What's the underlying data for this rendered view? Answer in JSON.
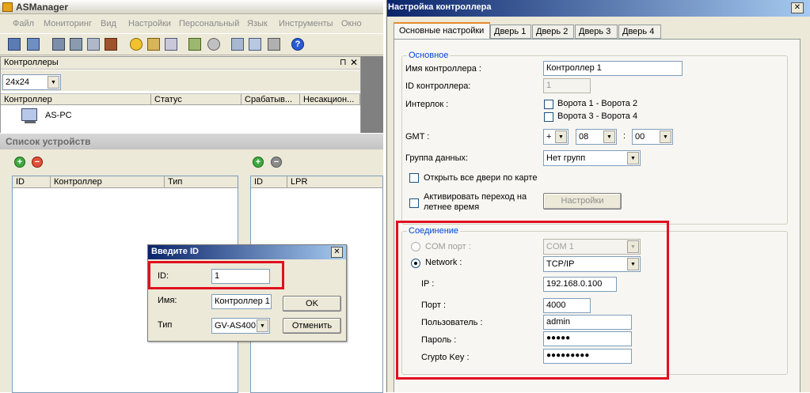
{
  "app": {
    "title": "ASManager",
    "menu": [
      "Файл",
      "Мониторинг",
      "Вид",
      "Настройки",
      "Персональный",
      "Язык",
      "Инструменты",
      "Окно"
    ]
  },
  "controllers_panel": {
    "title": "Контроллеры",
    "view_select": "24x24",
    "columns": [
      "Контроллер",
      "Статус",
      "Срабатыв...",
      "Несакцион..."
    ],
    "items": [
      {
        "name": "AS-PC"
      }
    ]
  },
  "devices_panel": {
    "title": "Список устройств",
    "left_columns": [
      "ID",
      "Контроллер",
      "Тип"
    ],
    "right_columns": [
      "ID",
      "LPR"
    ]
  },
  "enter_id_dialog": {
    "title": "Введите ID",
    "id_label": "ID:",
    "id_value": "1",
    "name_label": "Имя:",
    "name_value": "Контроллер 1",
    "type_label": "Тип",
    "type_value": "GV-AS400",
    "ok_label": "OK",
    "cancel_label": "Отменить"
  },
  "settings": {
    "title": "Настройка контроллера",
    "tabs": [
      "Основные настройки",
      "Дверь 1",
      "Дверь 2",
      "Дверь 3",
      "Дверь 4"
    ],
    "basic": {
      "group_title": "Основное",
      "name_label": "Имя контроллера :",
      "name_value": "Контроллер 1",
      "id_label": "ID контроллера:",
      "id_value": "1",
      "interlock_label": "Интерлок :",
      "interlock_option1": "Ворота 1 - Ворота 2",
      "interlock_option2": "Ворота 3 - Ворота 4",
      "gmt_label": "GMT :",
      "gmt_sign": "+",
      "gmt_hours": "08",
      "gmt_sep": ":",
      "gmt_minutes": "00",
      "data_group_label": "Группа данных:",
      "data_group_value": "Нет групп",
      "open_doors_label": "Открыть все двери по карте",
      "summer_time_label": "Активировать переход на летнее время",
      "settings_button": "Настройки"
    },
    "connection": {
      "group_title": "Соединение",
      "com_label": "COM порт :",
      "com_value": "COM 1",
      "network_label": "Network :",
      "network_value": "TCP/IP",
      "ip_label": "IP :",
      "ip_value": "192.168.0.100",
      "port_label": "Порт :",
      "port_value": "4000",
      "user_label": "Пользователь :",
      "user_value": "admin",
      "password_label": "Пароль :",
      "password_value": "●●●●●",
      "crypto_label": "Crypto Key :",
      "crypto_value": "●●●●●●●●●"
    }
  },
  "colors": {
    "title_bar": "#0a246a",
    "title_bar_end": "#a6caf0",
    "highlight_box": "#e0101e"
  }
}
